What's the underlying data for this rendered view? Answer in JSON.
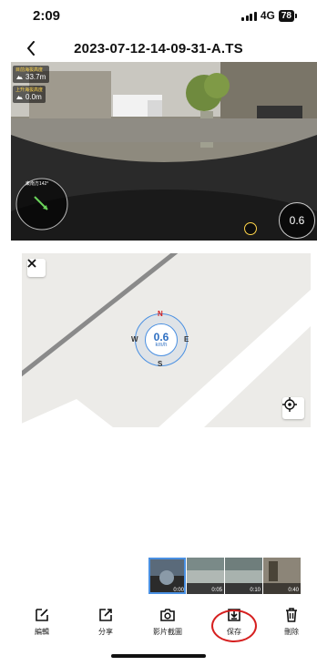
{
  "status_bar": {
    "time": "2:09",
    "network": "4G",
    "battery": "78"
  },
  "nav": {
    "title": "2023-07-12-14-09-31-A.TS"
  },
  "video_hud": {
    "top_label_1": "目前海拔高度",
    "altitude_now": "33.7m",
    "top_label_2": "上升海拔高度",
    "altitude_gain": "0.0m",
    "heading_label": "東南方142°",
    "speed": "0.6"
  },
  "map": {
    "speed": "0.6",
    "unit": "km/h",
    "dir_n": "N",
    "dir_s": "S",
    "dir_e": "E",
    "dir_w": "W"
  },
  "thumbnails": [
    {
      "time": "0:00"
    },
    {
      "time": "0:05"
    },
    {
      "time": "0:10"
    },
    {
      "time": "0:40"
    }
  ],
  "toolbar": {
    "edit": "編輯",
    "share": "分享",
    "screenshot": "影片截圖",
    "save": "保存",
    "delete": "刪除"
  },
  "colors": {
    "accent": "#4a90e2",
    "highlight_circle": "#d62020"
  }
}
